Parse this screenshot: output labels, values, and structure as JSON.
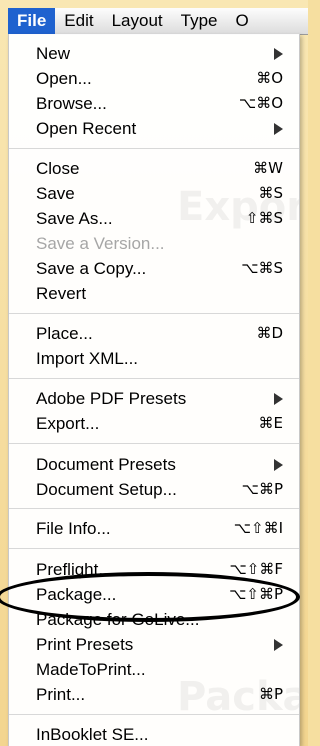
{
  "menubar": {
    "items": [
      "File",
      "Edit",
      "Layout",
      "Type",
      "O"
    ]
  },
  "menu": {
    "items": [
      {
        "label": "New",
        "shortcut": "",
        "submenu": true,
        "disabled": false
      },
      {
        "label": "Open...",
        "shortcut": "⌘O",
        "submenu": false,
        "disabled": false
      },
      {
        "label": "Browse...",
        "shortcut": "⌥⌘O",
        "submenu": false,
        "disabled": false
      },
      {
        "label": "Open Recent",
        "shortcut": "",
        "submenu": true,
        "disabled": false
      },
      {
        "label": "Close",
        "shortcut": "⌘W",
        "submenu": false,
        "disabled": false
      },
      {
        "label": "Save",
        "shortcut": "⌘S",
        "submenu": false,
        "disabled": false
      },
      {
        "label": "Save As...",
        "shortcut": "⇧⌘S",
        "submenu": false,
        "disabled": false
      },
      {
        "label": "Save a Version...",
        "shortcut": "",
        "submenu": false,
        "disabled": true
      },
      {
        "label": "Save a Copy...",
        "shortcut": "⌥⌘S",
        "submenu": false,
        "disabled": false
      },
      {
        "label": "Revert",
        "shortcut": "",
        "submenu": false,
        "disabled": false
      },
      {
        "label": "Place...",
        "shortcut": "⌘D",
        "submenu": false,
        "disabled": false
      },
      {
        "label": "Import XML...",
        "shortcut": "",
        "submenu": false,
        "disabled": false
      },
      {
        "label": "Adobe PDF Presets",
        "shortcut": "",
        "submenu": true,
        "disabled": false
      },
      {
        "label": "Export...",
        "shortcut": "⌘E",
        "submenu": false,
        "disabled": false
      },
      {
        "label": "Document Presets",
        "shortcut": "",
        "submenu": true,
        "disabled": false
      },
      {
        "label": "Document Setup...",
        "shortcut": "⌥⌘P",
        "submenu": false,
        "disabled": false
      },
      {
        "label": "File Info...",
        "shortcut": "⌥⇧⌘I",
        "submenu": false,
        "disabled": false
      },
      {
        "label": "Preflight...",
        "shortcut": "⌥⇧⌘F",
        "submenu": false,
        "disabled": false
      },
      {
        "label": "Package...",
        "shortcut": "⌥⇧⌘P",
        "submenu": false,
        "disabled": false
      },
      {
        "label": "Package for GoLive...",
        "shortcut": "",
        "submenu": false,
        "disabled": false
      },
      {
        "label": "Print Presets",
        "shortcut": "",
        "submenu": true,
        "disabled": false
      },
      {
        "label": "MadeToPrint...",
        "shortcut": "",
        "submenu": false,
        "disabled": false
      },
      {
        "label": "Print...",
        "shortcut": "⌘P",
        "submenu": false,
        "disabled": false
      },
      {
        "label": "InBooklet SE...",
        "shortcut": "",
        "submenu": false,
        "disabled": false
      }
    ]
  },
  "background": {
    "ghost_texts": [
      "Expor",
      "Package"
    ]
  },
  "colors": {
    "menubar_active": "#1f62cf",
    "disabled_text": "#a6a6a6",
    "backdrop": "#f3d58f"
  }
}
